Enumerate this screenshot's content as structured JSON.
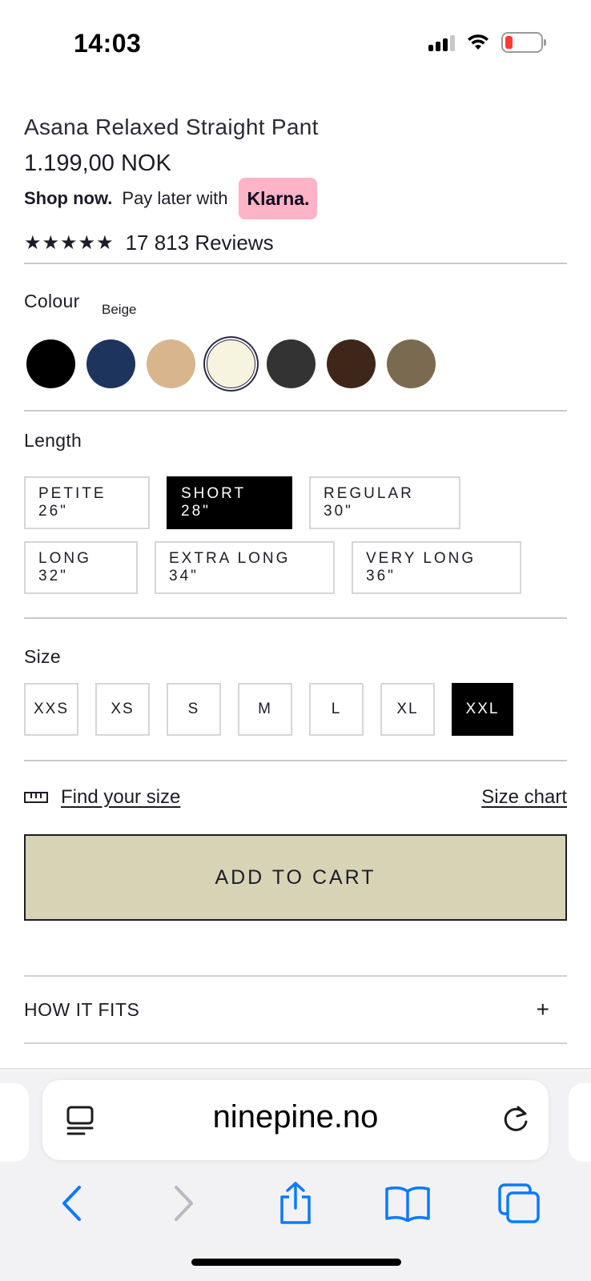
{
  "status_bar": {
    "time": "14:03",
    "icons": [
      "signal-icon",
      "wifi-icon",
      "battery-icon"
    ],
    "battery_color": "#ff3b30"
  },
  "product": {
    "name": "Asana Relaxed Straight Pant",
    "price": "1.199,00 NOK",
    "klarna": {
      "bold": "Shop now.",
      "text": "Pay later with",
      "badge": "Klarna.",
      "badge_color": "#ffb3c7"
    },
    "rating": {
      "stars": "★★★★★",
      "reviews": "17 813 Reviews"
    }
  },
  "colour": {
    "label": "Colour",
    "selected": "Beige",
    "swatches": [
      {
        "color": "#000000"
      },
      {
        "color": "#1d355d"
      },
      {
        "color": "#d8b58d"
      },
      {
        "color": "#f6f3df",
        "selected": true
      },
      {
        "color": "#333333"
      },
      {
        "color": "#3e2619"
      },
      {
        "color": "#7a6a4f"
      }
    ]
  },
  "length": {
    "label": "Length",
    "options": [
      "PETITE 26\"",
      "SHORT 28\"",
      "REGULAR 30\"",
      "LONG 32\"",
      "EXTRA LONG 34\"",
      "VERY LONG 36\""
    ],
    "selected": "SHORT 28\""
  },
  "size": {
    "label": "Size",
    "options": [
      "XXS",
      "XS",
      "S",
      "M",
      "L",
      "XL",
      "XXL"
    ],
    "selected": "XXL"
  },
  "find_size": {
    "link": "Find your size",
    "chart_link": "Size chart"
  },
  "add_to_cart": {
    "label": "ADD TO CART",
    "color": "#d7d3b5"
  },
  "accordion": {
    "label": "HOW IT FITS",
    "icon": "+"
  },
  "browser": {
    "url": "ninepine.no",
    "accent": "#0a7aff"
  }
}
